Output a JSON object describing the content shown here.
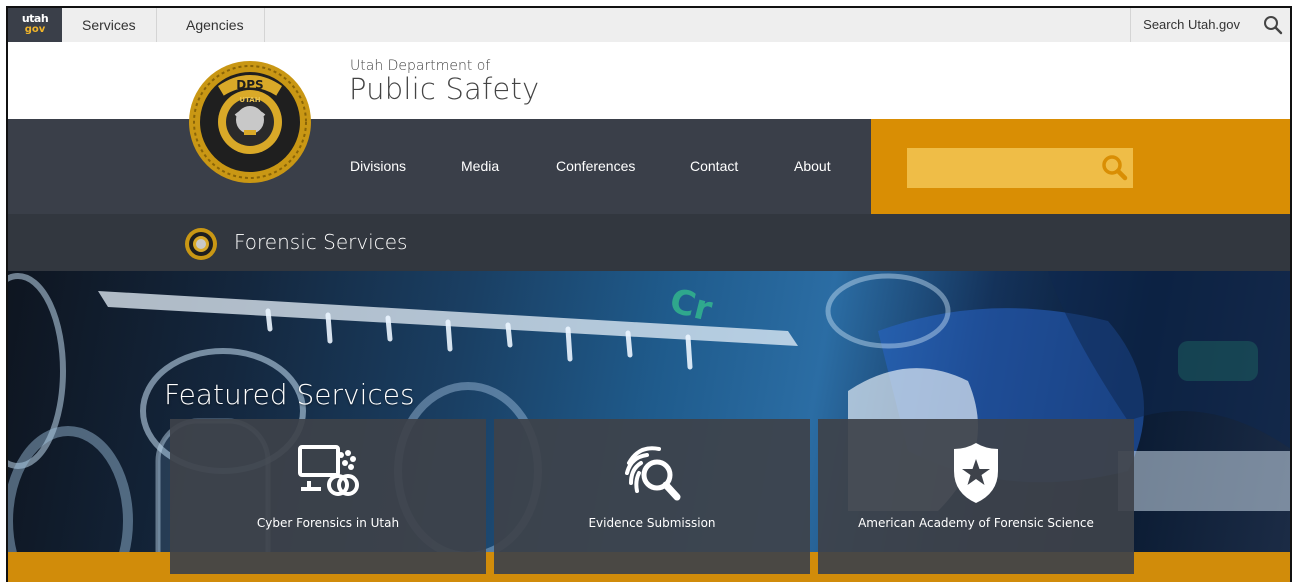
{
  "topbar": {
    "logo_line1": "utah",
    "logo_line2": "gov",
    "services": "Services",
    "agencies": "Agencies",
    "search_label": "Search Utah.gov"
  },
  "header": {
    "dept_line1": "Utah Department of",
    "dept_line2": "Public Safety",
    "seal_top": "DPS",
    "seal_ring": "UTAH"
  },
  "nav": {
    "items": [
      "Divisions",
      "Media",
      "Conferences",
      "Contact",
      "About"
    ],
    "search_placeholder": ""
  },
  "subheader": {
    "title": "Forensic Services"
  },
  "hero": {
    "heading": "Featured Services",
    "cards": [
      {
        "label": "Cyber Forensics in Utah",
        "icon": "cyber-forensics-icon"
      },
      {
        "label": "Evidence Submission",
        "icon": "fingerprint-search-icon"
      },
      {
        "label": "American Academy of Forensic Science",
        "icon": "police-badge-icon"
      }
    ]
  },
  "colors": {
    "dark_nav": "#3a3f49",
    "subbar": "#32373f",
    "gold": "#d98e04",
    "gold_search": "#efbd47"
  }
}
